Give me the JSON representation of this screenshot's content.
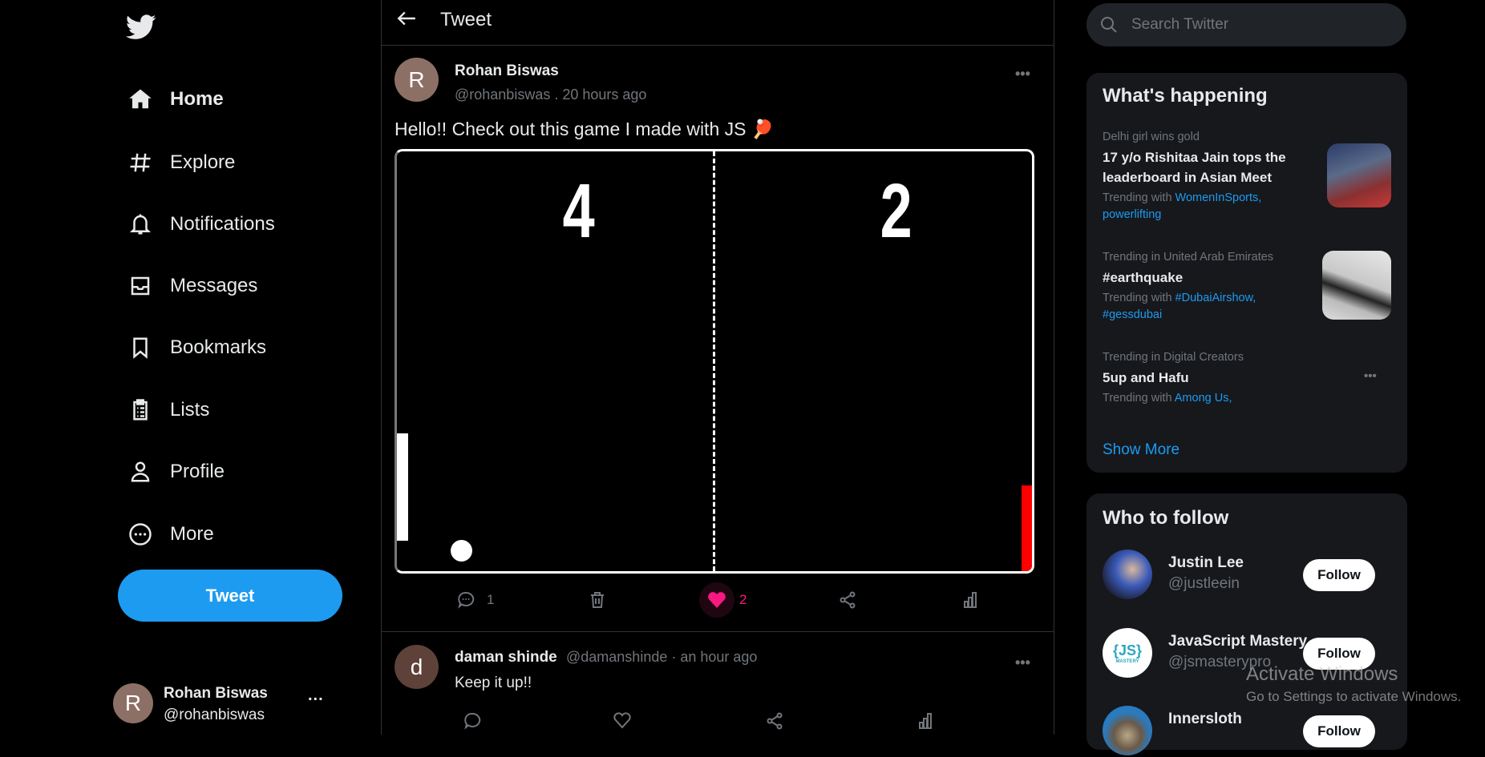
{
  "sidebar": {
    "logo": "twitter-bird-icon",
    "items": [
      {
        "label": "Home",
        "icon": "home-icon",
        "active": true
      },
      {
        "label": "Explore",
        "icon": "hashtag-icon"
      },
      {
        "label": "Notifications",
        "icon": "bell-icon"
      },
      {
        "label": "Messages",
        "icon": "inbox-icon"
      },
      {
        "label": "Bookmarks",
        "icon": "bookmark-icon"
      },
      {
        "label": "Lists",
        "icon": "clipboard-icon"
      },
      {
        "label": "Profile",
        "icon": "user-icon"
      },
      {
        "label": "More",
        "icon": "more-circle-icon"
      }
    ],
    "tweet_button": "Tweet",
    "account": {
      "initial": "R",
      "name": "Rohan Biswas",
      "handle": "@rohanbiswas",
      "more": "..."
    }
  },
  "header": {
    "title": "Tweet"
  },
  "tweet": {
    "initial": "R",
    "name": "Rohan Biswas",
    "handle_time": "@rohanbiswas . 20 hours ago",
    "text": "Hello!! Check out this game I made with JS 🏓",
    "game": {
      "score_left": "4",
      "score_right": "2",
      "right_paddle_color": "#ff0000"
    },
    "actions": {
      "replies": "1",
      "likes": "2",
      "liked": true
    }
  },
  "reply": {
    "initial": "d",
    "name": "daman shinde",
    "handle_time": "@damanshinde · an hour ago",
    "text": "Keep it up!!"
  },
  "search": {
    "placeholder": "Search Twitter"
  },
  "trends": {
    "title": "What's happening",
    "items": [
      {
        "category": "Delhi girl wins gold",
        "title": "17 y/o Rishitaa Jain tops the leaderboard in Asian Meet",
        "with_label": "Trending with",
        "with": "WomenInSports, powerlifting"
      },
      {
        "category": "Trending in United Arab Emirates",
        "title": "#earthquake",
        "with_label": "Trending with",
        "with": "#DubaiAirshow, #gessdubai"
      },
      {
        "category": "Trending in Digital Creators",
        "title": "5up and Hafu",
        "with_label": "Trending with",
        "with": "Among Us,"
      }
    ],
    "show_more": "Show More"
  },
  "who_to_follow": {
    "title": "Who to follow",
    "follow_label": "Follow",
    "users": [
      {
        "name": "Justin Lee",
        "handle": "@justleein"
      },
      {
        "name": "JavaScript Mastery",
        "handle": "@jsmasterypro",
        "logo_text": "{JS}",
        "logo_sub": "MASTERY"
      },
      {
        "name": "Innersloth",
        "handle": ""
      }
    ]
  },
  "watermark": {
    "title": "Activate Windows",
    "subtitle": "Go to Settings to activate Windows."
  },
  "colors": {
    "accent": "#1d9bf0",
    "like": "#f91880",
    "card_bg": "#16181c"
  }
}
